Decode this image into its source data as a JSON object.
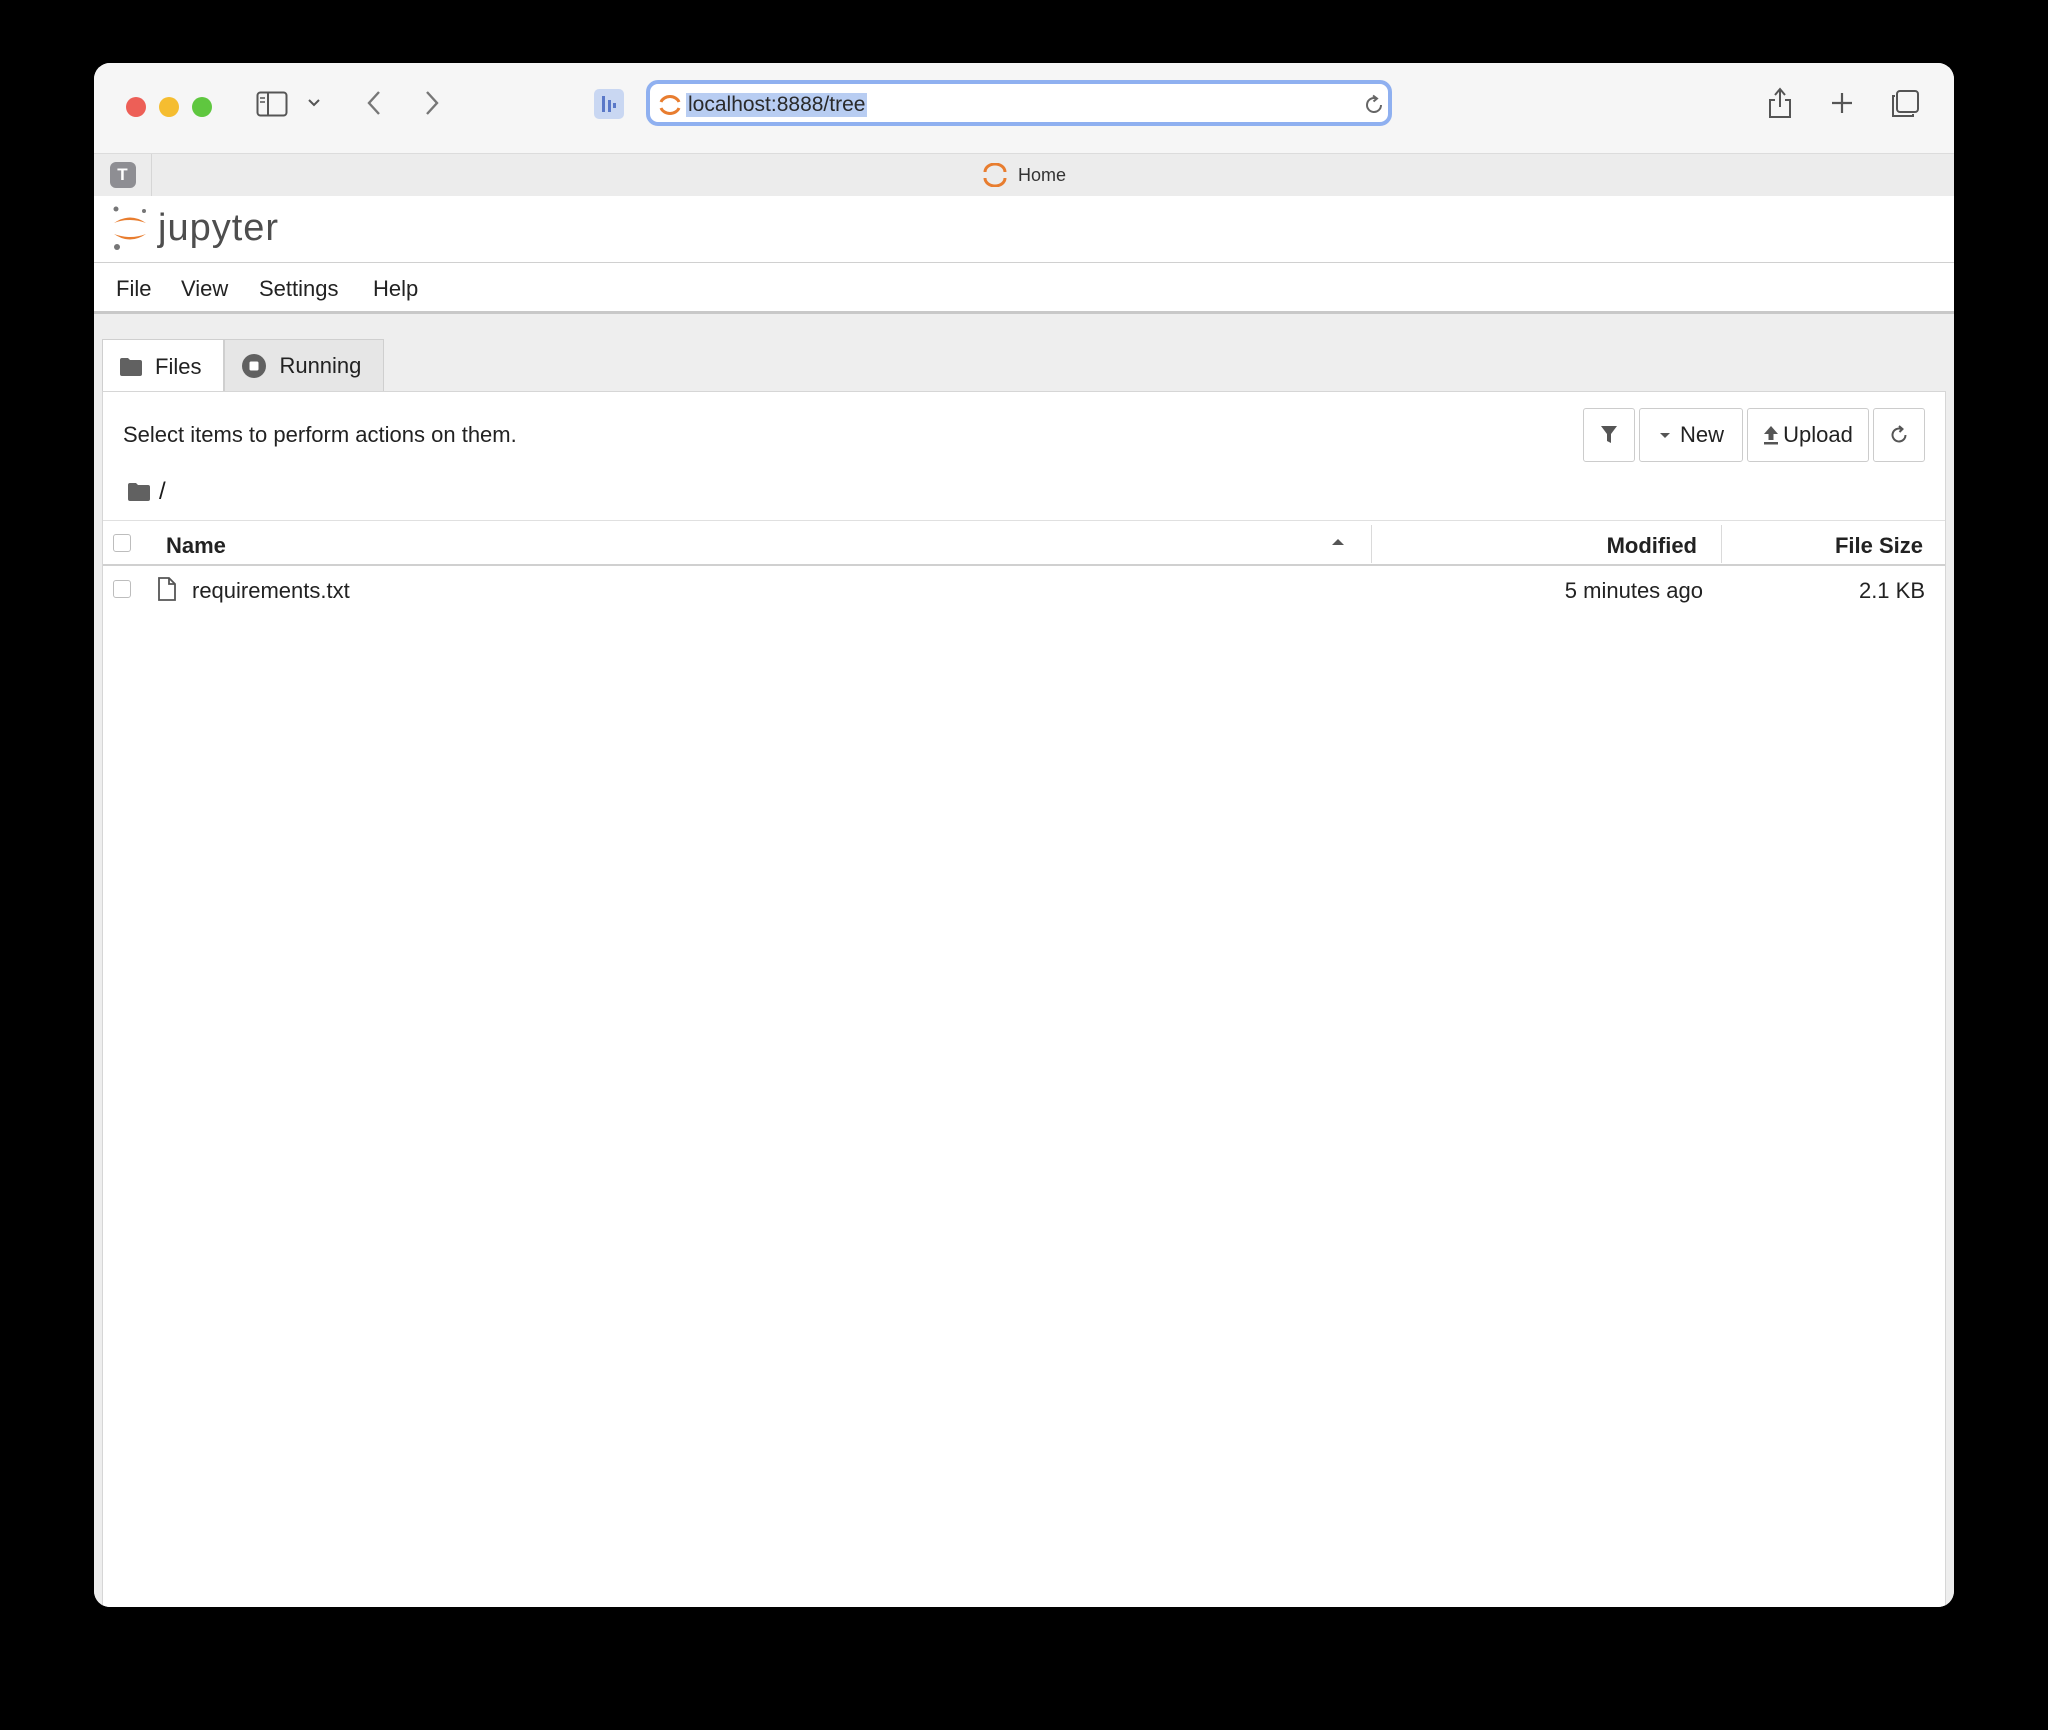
{
  "browser": {
    "url": "localhost:8888/tree",
    "pinned_tab_letter": "T",
    "tab_title": "Home"
  },
  "app": {
    "logo_word": "jupyter",
    "menu": [
      "File",
      "View",
      "Settings",
      "Help"
    ],
    "tabs": [
      {
        "label": "Files",
        "active": true
      },
      {
        "label": "Running",
        "active": false
      }
    ],
    "select_message": "Select items to perform actions on them.",
    "buttons": {
      "new": "New",
      "upload": "Upload"
    },
    "breadcrumb": "/",
    "columns": {
      "name": "Name",
      "modified": "Modified",
      "size": "File Size"
    },
    "files": [
      {
        "name": "requirements.txt",
        "modified": "5 minutes ago",
        "size": "2.1 KB"
      }
    ],
    "colors": {
      "jupyter_orange": "#e87d2f",
      "url_highlight": "#b8cdf2",
      "focus_ring": "#8fb0f0"
    }
  }
}
